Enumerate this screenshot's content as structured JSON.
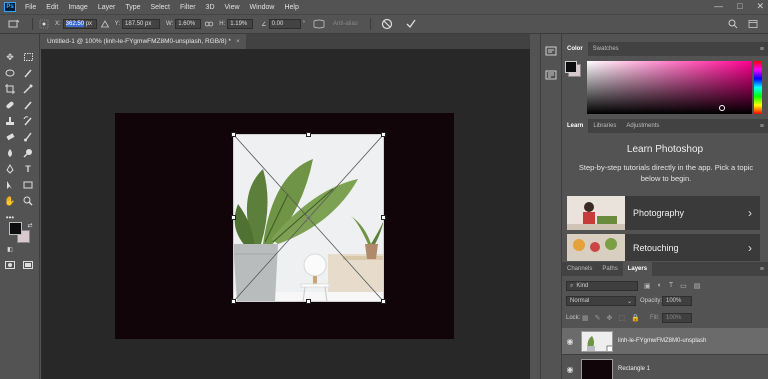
{
  "app": {
    "logo_text": "Ps",
    "menu": [
      "File",
      "Edit",
      "Image",
      "Layer",
      "Type",
      "Select",
      "Filter",
      "3D",
      "View",
      "Window",
      "Help"
    ],
    "window_controls": [
      "—",
      "□",
      "✕"
    ]
  },
  "options": {
    "x_label": "X:",
    "x_value": "362.50",
    "x_unit": "px",
    "y_label": "Y:",
    "y_value": "187.50 px",
    "w_label": "W:",
    "w_value": "1.60%",
    "h_label": "H:",
    "h_value": "1.19%",
    "angle_label": "∠",
    "angle_value": "0.00",
    "degree": "°",
    "h_skew_label": "H:",
    "interp_label": "Bicubic",
    "interp_partial": "Anti-alias"
  },
  "document": {
    "tab_title": "Untitled-1 @ 100% (linh-le-FYgmwFMZ8M0-unsplash, RGB/8) *",
    "close_glyph": "×"
  },
  "color_panel": {
    "tabs": [
      "Color",
      "Swatches"
    ],
    "foreground": "#0c0b0d",
    "background": "#d9c9cf"
  },
  "learn_panel": {
    "tabs": [
      "Learn",
      "Libraries",
      "Adjustments"
    ],
    "heading": "Learn Photoshop",
    "description": "Step-by-step tutorials directly in the app. Pick a topic below to begin.",
    "cards": [
      {
        "label": "Photography"
      },
      {
        "label": "Retouching"
      }
    ]
  },
  "layers_panel": {
    "tabs": [
      "Channels",
      "Paths",
      "Layers"
    ],
    "kind_placeholder": "Kind",
    "blend_mode": "Normal",
    "opacity_label": "Opacity:",
    "opacity_value": "100%",
    "lock_label": "Lock:",
    "fill_label": "Fill:",
    "fill_value": "100%",
    "layers": [
      {
        "name": "linh-le-FYgmwFMZ8M0-unsplash",
        "selected": true
      },
      {
        "name": "Rectangle 1",
        "selected": false
      }
    ]
  },
  "colors": {
    "accent": "#31a8ff",
    "selected_layer": "#6b6b6b",
    "canvas_bg": "#282828"
  }
}
